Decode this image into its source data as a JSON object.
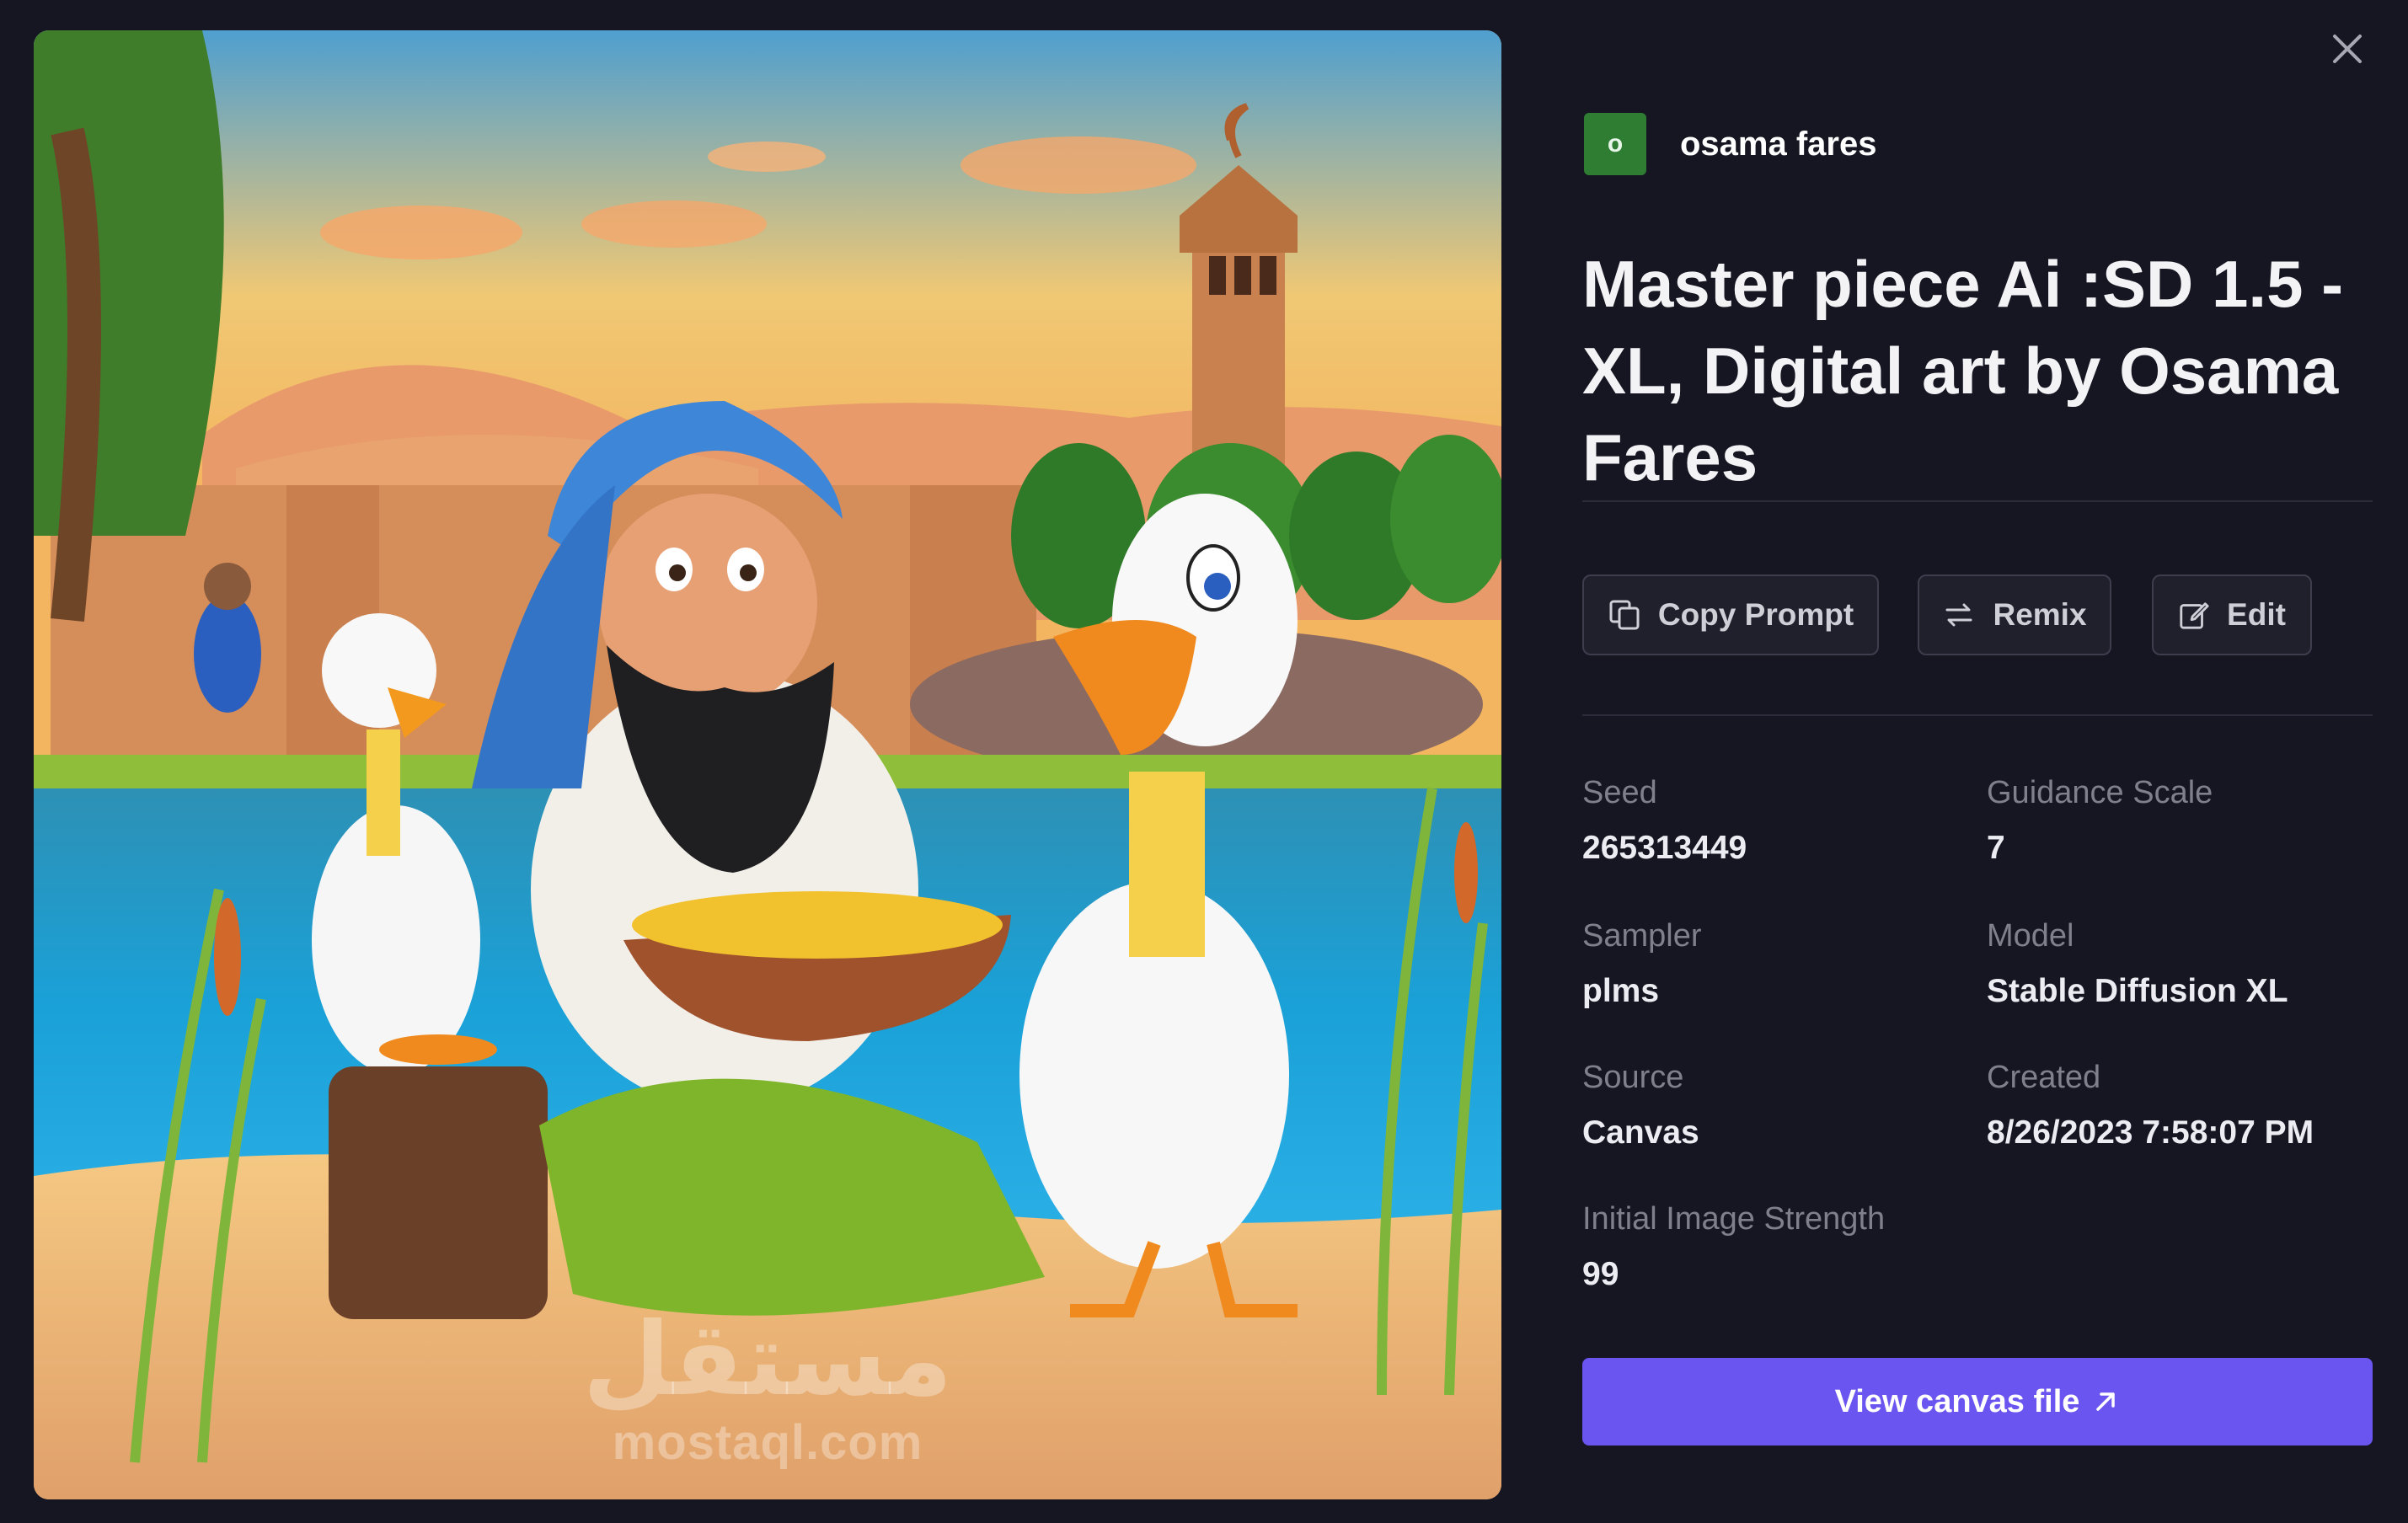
{
  "image": {
    "description_icon": "generated-artwork",
    "watermark_arabic": "مستقل",
    "watermark_latin": "mostaql.com"
  },
  "close_icon": "close-icon",
  "author": {
    "initial": "o",
    "name": "osama fares",
    "avatar_color": "#2e7d32"
  },
  "title": "Master piece Ai :SD 1.5 - XL, Digital art by Osama Fares",
  "actions": {
    "copy_prompt": "Copy Prompt",
    "remix": "Remix",
    "edit": "Edit"
  },
  "details": {
    "seed_label": "Seed",
    "seed_value": "265313449",
    "guidance_label": "Guidance Scale",
    "guidance_value": "7",
    "sampler_label": "Sampler",
    "sampler_value": "plms",
    "model_label": "Model",
    "model_value": "Stable Diffusion XL",
    "source_label": "Source",
    "source_value": "Canvas",
    "created_label": "Created",
    "created_value": "8/26/2023 7:58:07 PM",
    "strength_label": "Initial Image Strength",
    "strength_value": "99"
  },
  "cta": {
    "label": "View canvas file",
    "color": "#6a55f0"
  },
  "colors": {
    "background": "#161622",
    "button_border": "#3d3d4e",
    "label_gray": "#80808c"
  }
}
